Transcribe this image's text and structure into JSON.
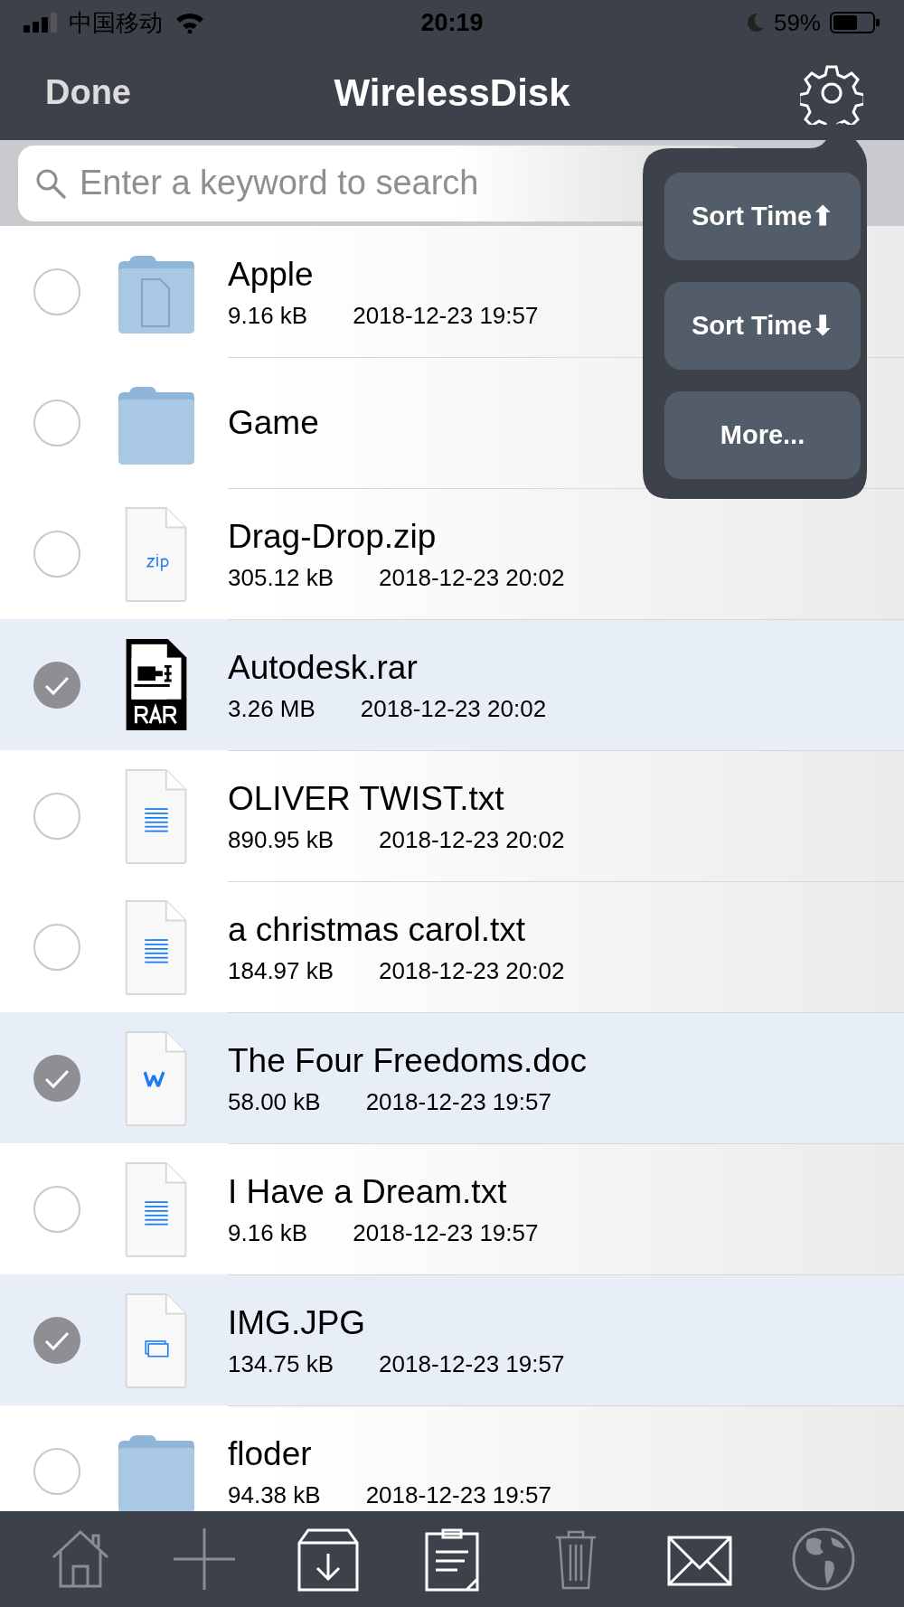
{
  "status_bar": {
    "carrier": "中国移动",
    "time": "20:19",
    "battery": "59%"
  },
  "nav": {
    "left_button": "Done",
    "title": "WirelessDisk"
  },
  "search": {
    "placeholder": "Enter a keyword to search"
  },
  "sort_menu": {
    "items": [
      "Sort Time⬆",
      "Sort Time⬇",
      "More..."
    ]
  },
  "files": [
    {
      "name": "Apple",
      "kind": "folder-doc",
      "size": "9.16 kB",
      "date": "2018-12-23 19:57",
      "selected": false
    },
    {
      "name": "Game",
      "kind": "folder",
      "selected": false
    },
    {
      "name": "Drag-Drop.zip",
      "kind": "zip",
      "size": "305.12 kB",
      "date": "2018-12-23 20:02",
      "selected": false
    },
    {
      "name": "Autodesk.rar",
      "kind": "rar",
      "size": "3.26 MB",
      "date": "2018-12-23 20:02",
      "selected": true
    },
    {
      "name": "OLIVER TWIST.txt",
      "kind": "txt",
      "size": "890.95 kB",
      "date": "2018-12-23 20:02",
      "selected": false
    },
    {
      "name": "a christmas carol.txt",
      "kind": "txt",
      "size": "184.97 kB",
      "date": "2018-12-23 20:02",
      "selected": false
    },
    {
      "name": "The Four Freedoms.doc",
      "kind": "word",
      "size": "58.00 kB",
      "date": "2018-12-23 19:57",
      "selected": true
    },
    {
      "name": "I Have a Dream.txt",
      "kind": "txt",
      "size": "9.16 kB",
      "date": "2018-12-23 19:57",
      "selected": false
    },
    {
      "name": "IMG.JPG",
      "kind": "image",
      "size": "134.75 kB",
      "date": "2018-12-23 19:57",
      "selected": true
    },
    {
      "name": "floder",
      "kind": "folder",
      "size": "94.38 kB",
      "date": "2018-12-23 19:57",
      "selected": false
    }
  ],
  "toolbar": [
    {
      "kind": "home",
      "disabled": true
    },
    {
      "kind": "add",
      "disabled": true
    },
    {
      "kind": "download",
      "disabled": false
    },
    {
      "kind": "clipboard",
      "disabled": false
    },
    {
      "kind": "trash",
      "disabled": true
    },
    {
      "kind": "mail",
      "disabled": false
    },
    {
      "kind": "globe",
      "disabled": true
    }
  ]
}
